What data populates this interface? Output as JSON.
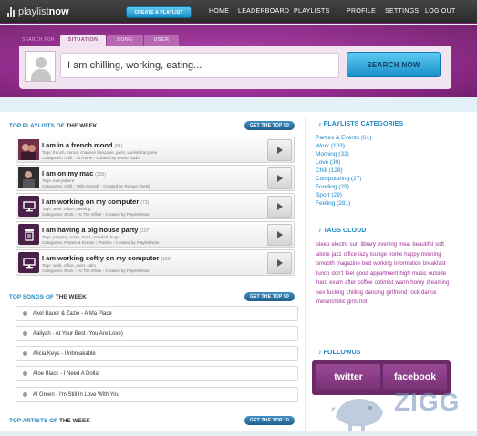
{
  "header": {
    "logo_a": "playlist",
    "logo_b": "now",
    "create_button": "CREATE A PLAYLIST",
    "nav": [
      "HOME",
      "LEADERBOARD",
      "PLAYLISTS",
      "PROFILE",
      "SETTINGS",
      "LOG OUT"
    ]
  },
  "search": {
    "label": "SEARCH FOR",
    "tabs": [
      "SITUATION",
      "SONG",
      "USER"
    ],
    "active_tab": "SITUATION",
    "value": "I am chilling, working, eating...",
    "button": "SEARCH NOW"
  },
  "top_playlists": {
    "title_a": "TOP PLAYLISTS OF",
    "title_b": "THE WEEK",
    "button": "GET THE TOP 50",
    "items": [
      {
        "title": "I am in a french mood",
        "count": "(91)",
        "tags": "Tags: french, france, chanson française, paris, variété française",
        "cats": "Categories: Chill  ::  At Home  -  Created by Bruno Rado"
      },
      {
        "title": "I am on my mac",
        "count": "(335)",
        "tags": "Tags: everywhere",
        "cats": "Categories: Chill  ::  With Friends  -  Created by Roman Orekil"
      },
      {
        "title": "I am working on my computer",
        "count": "(73)",
        "tags": "Tags: work, office, meeting",
        "cats": "Categories: Work  ::  At The Office  -  Created by Playlist Now"
      },
      {
        "title": "I am having a big house party",
        "count": "(107)",
        "tags": "Tags: partying, noise, hard, crowded, huge",
        "cats": "Categories: Parties & Events  ::  Parties  -  Created by Playlist Now"
      },
      {
        "title": "I am working softly on my computer",
        "count": "(130)",
        "tags": "Tags: work, office, quiet, calm",
        "cats": "Categories: Work  ::  At The Office  -  Created by Playlist Now"
      }
    ]
  },
  "top_songs": {
    "title_a": "TOP SONGS OF",
    "title_b": "THE WEEK",
    "button": "GET THE TOP 50",
    "items": [
      "Axel Bauer & Zazie - A Ma Place",
      "Aaliyah - At Your Best (You Are Love)",
      "Alicia Keys - Unbreakable",
      "Aloe Blacc - I Need A Dollar",
      "Al Green - I'm Still In Love With You"
    ]
  },
  "top_artists": {
    "title_a": "TOP ARTISTS OF",
    "title_b": "THE WEEK",
    "button": "GET THE TOP 10"
  },
  "categories": {
    "title": "PLAYLISTS CATEGORIES",
    "items": [
      "Parties & Events (61)",
      "Work (103)",
      "Morning (32)",
      "Love (30)",
      "Chill (128)",
      "Computering (27)",
      "Fooding (29)",
      "Sport (29)",
      "Feeling (281)"
    ]
  },
  "tags_cloud": {
    "title": "TAGS CLOUD",
    "text": "sleep electro sun library evening meal beautiful soft alone jazz office lazy lounge home happy morning smooth magazine bed working information breakfast lunch don't feel good appartment high music outside hard exam after coffee optimist warm horny dreaming sex fucking chilling dancing girlfriend rock dance melancholic girls hot"
  },
  "followus": {
    "title": "FOLLOWUS",
    "twitter": "twitter",
    "facebook": "facebook"
  },
  "watermark": "ZIGG",
  "colors": {
    "accent": "#1d86c2",
    "brand": "#9c2f97",
    "tags": "#a02f95"
  }
}
